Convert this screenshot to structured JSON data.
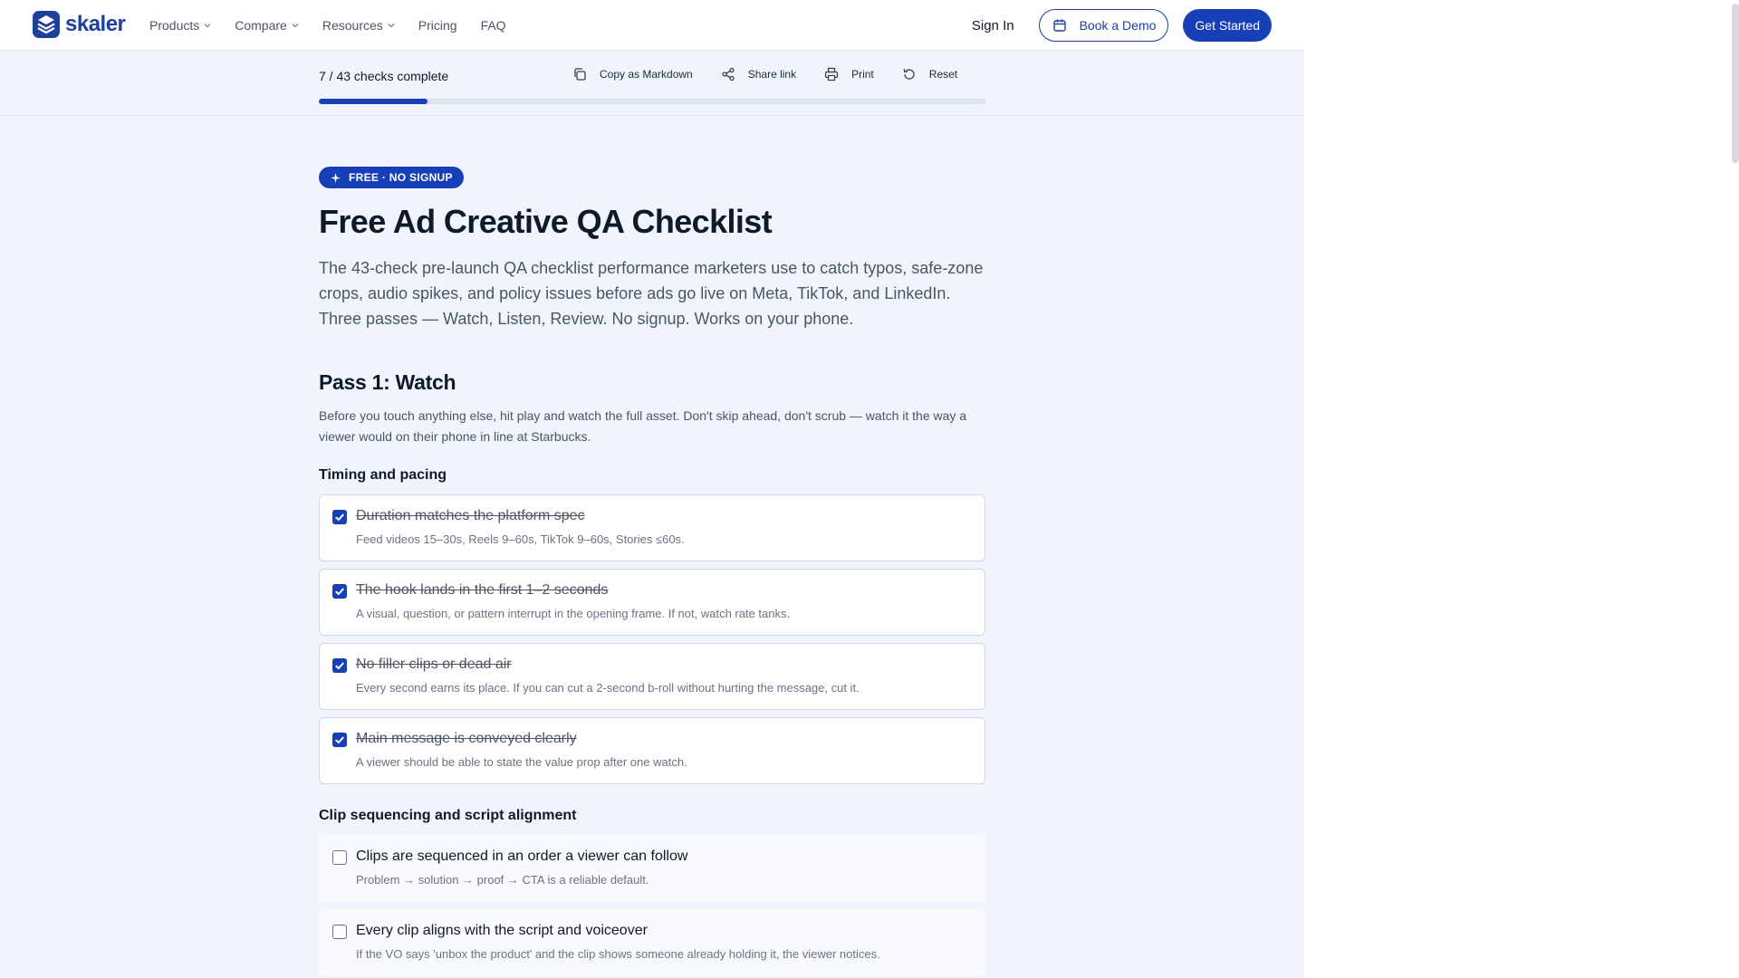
{
  "nav": {
    "logo_text": "skaler",
    "links": [
      {
        "label": "Products",
        "dropdown": true
      },
      {
        "label": "Compare",
        "dropdown": true
      },
      {
        "label": "Resources",
        "dropdown": true
      },
      {
        "label": "Pricing",
        "dropdown": false
      },
      {
        "label": "FAQ",
        "dropdown": false
      }
    ],
    "sign_in": "Sign In",
    "book_demo": "Book a Demo",
    "get_started": "Get Started"
  },
  "toolbar": {
    "progress_text": "7 / 43 checks complete",
    "progress_fraction": 0.163,
    "copy_markdown": "Copy as Markdown",
    "share_link": "Share link",
    "print": "Print",
    "reset": "Reset"
  },
  "hero": {
    "badge": "FREE · NO SIGNUP",
    "title": "Free Ad Creative QA Checklist",
    "intro": "The 43-check pre-launch QA checklist performance marketers use to catch typos, safe-zone crops, audio spikes, and policy issues before ads go live on Meta, TikTok, and LinkedIn. Three passes — Watch, Listen, Review. No signup. Works on your phone."
  },
  "pass1": {
    "title": "Pass 1: Watch",
    "description": "Before you touch anything else, hit play and watch the full asset. Don't skip ahead, don't scrub — watch it the way a viewer would on their phone in line at Starbucks.",
    "groups": [
      {
        "title": "Timing and pacing",
        "items": [
          {
            "title": "Duration matches the platform spec",
            "desc": "Feed videos 15–30s, Reels 9–60s, TikTok 9–60s, Stories ≤60s.",
            "checked": true
          },
          {
            "title": "The hook lands in the first 1–2 seconds",
            "desc": "A visual, question, or pattern interrupt in the opening frame. If not, watch rate tanks.",
            "checked": true
          },
          {
            "title": "No filler clips or dead air",
            "desc": "Every second earns its place. If you can cut a 2-second b-roll without hurting the message, cut it.",
            "checked": true
          },
          {
            "title": "Main message is conveyed clearly",
            "desc": "A viewer should be able to state the value prop after one watch.",
            "checked": true
          }
        ]
      },
      {
        "title": "Clip sequencing and script alignment",
        "items": [
          {
            "title": "Clips are sequenced in an order a viewer can follow",
            "desc": "Problem → solution → proof → CTA is a reliable default.",
            "checked": false
          },
          {
            "title": "Every clip aligns with the script and voiceover",
            "desc": "If the VO says 'unbox the product' and the clip shows someone already holding it, the viewer notices.",
            "checked": false
          }
        ]
      }
    ]
  },
  "colors": {
    "brand": "#1740b8",
    "page_bg": "#f0f5fd"
  }
}
